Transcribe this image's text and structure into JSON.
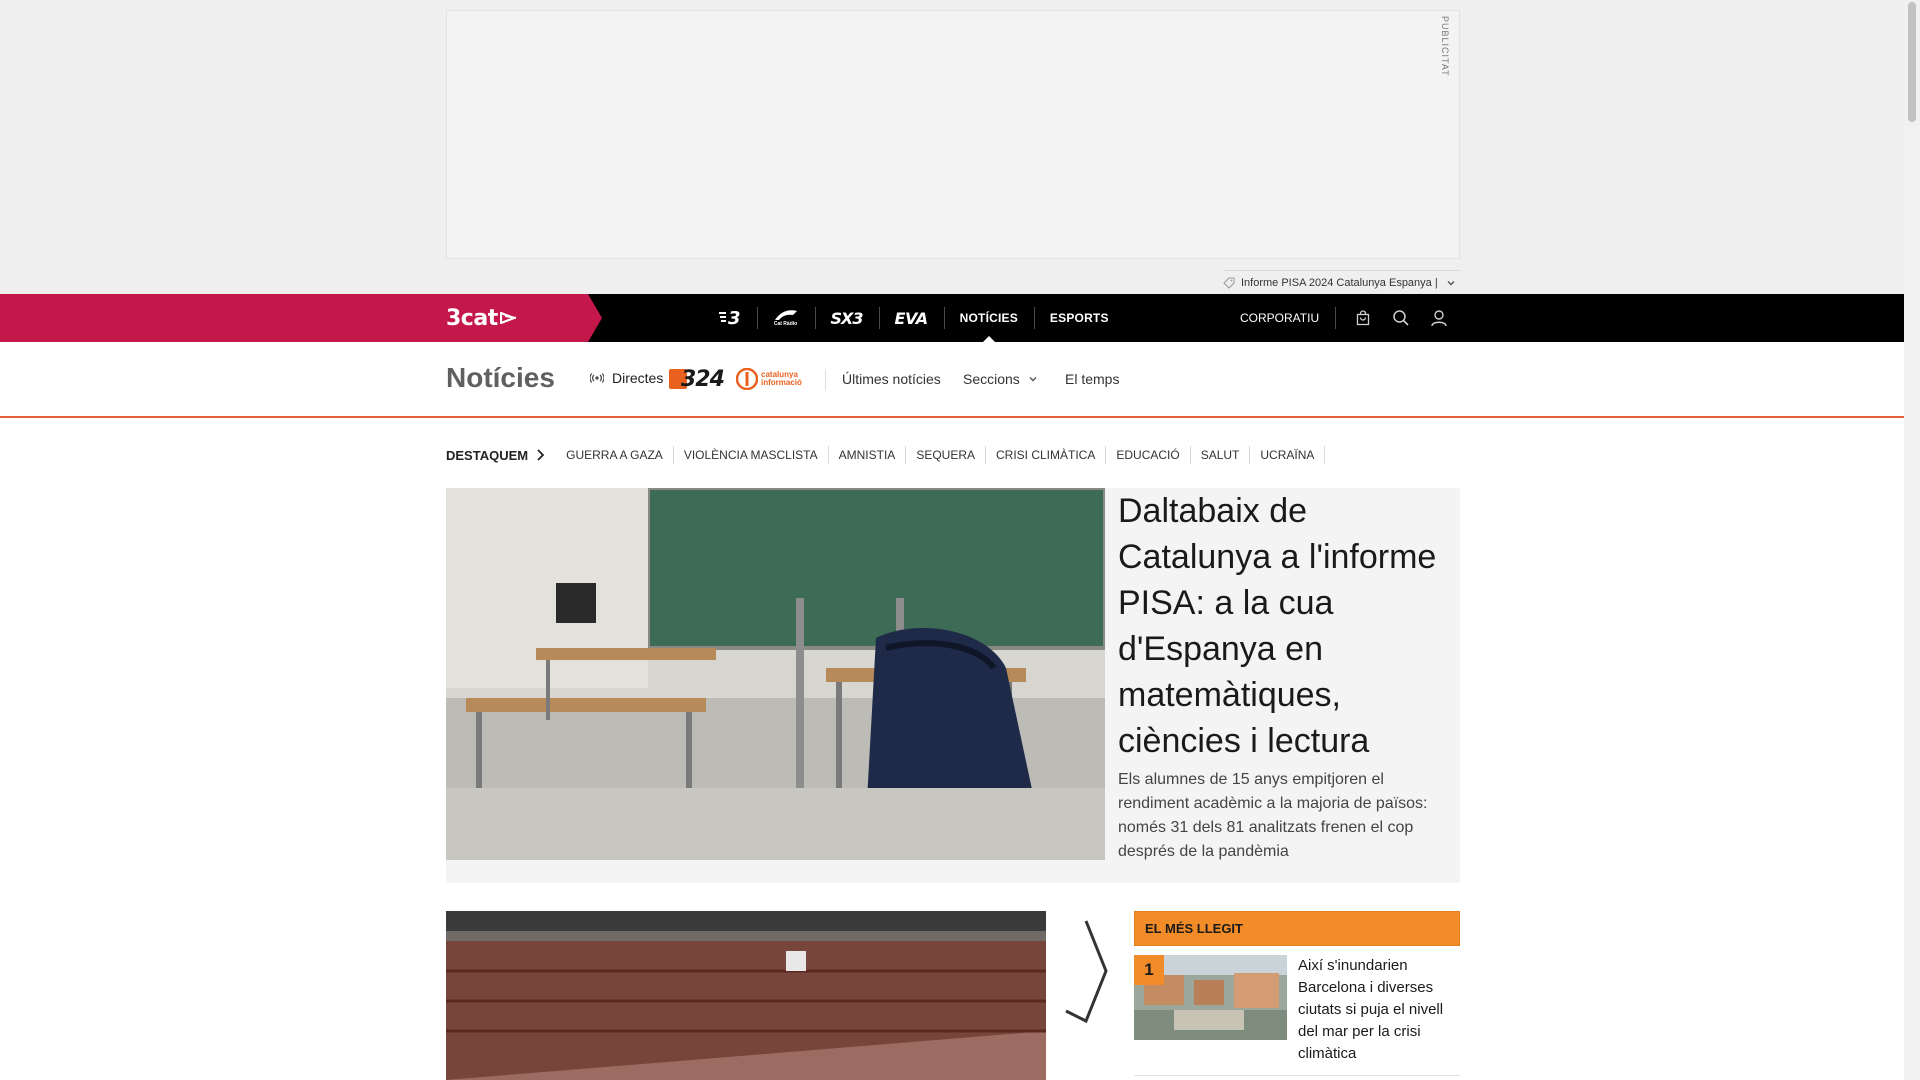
{
  "ad": {
    "label": "PUBLICITAT",
    "topic_tag": "Informe PISA 2024 Catalunya Espanya |"
  },
  "topnav": {
    "brand": "3cat",
    "channels": [
      {
        "label": "3",
        "icon": "tv3-logo"
      },
      {
        "label": "Cat Ràdio",
        "icon": "catradio-logo"
      },
      {
        "label": "SX3",
        "icon": "sx3-logo"
      },
      {
        "label": "EVA",
        "icon": "eva-logo"
      },
      {
        "label": "NOTÍCIES",
        "active": true
      },
      {
        "label": "ESPORTS"
      }
    ],
    "corporate": "CORPORATIU",
    "icons": [
      "shopping-bag-icon",
      "search-icon",
      "user-icon"
    ]
  },
  "section": {
    "title": "Notícies",
    "live_label": "Directes",
    "logo_324": "324",
    "logo_ci_line1": "catalunya",
    "logo_ci_line2": "informació",
    "links": {
      "latest": "Últimes notícies",
      "sections": "Seccions",
      "weather": "El temps"
    }
  },
  "highlights": {
    "lead": "DESTAQUEM",
    "items": [
      "GUERRA A GAZA",
      "VIOLÈNCIA MASCLISTA",
      "AMNISTIA",
      "SEQUERA",
      "CRISI CLIMÀTICA",
      "EDUCACIÓ",
      "SALUT",
      "UCRAÏNA"
    ]
  },
  "hero": {
    "title": "Daltabaix de Catalunya a l'informe PISA: a la cua d'Espanya en matemàtiques, ciències i lectura",
    "subtitle": "Els alumnes de 15 anys empitjoren el rendiment acadèmic a la majoria de països: només 31 dels 81 analitzats frenen el cop després de la pandèmia"
  },
  "most_read": {
    "heading": "EL MÉS LLEGIT",
    "items": [
      {
        "rank": "1",
        "title": "Així s'inundarien Barcelona i diverses ciutats si puja el nivell del mar per la crisi climàtica"
      }
    ]
  },
  "colors": {
    "brand_red": "#c4174a",
    "accent_orange": "#f28c28",
    "nav_black": "#000000"
  }
}
